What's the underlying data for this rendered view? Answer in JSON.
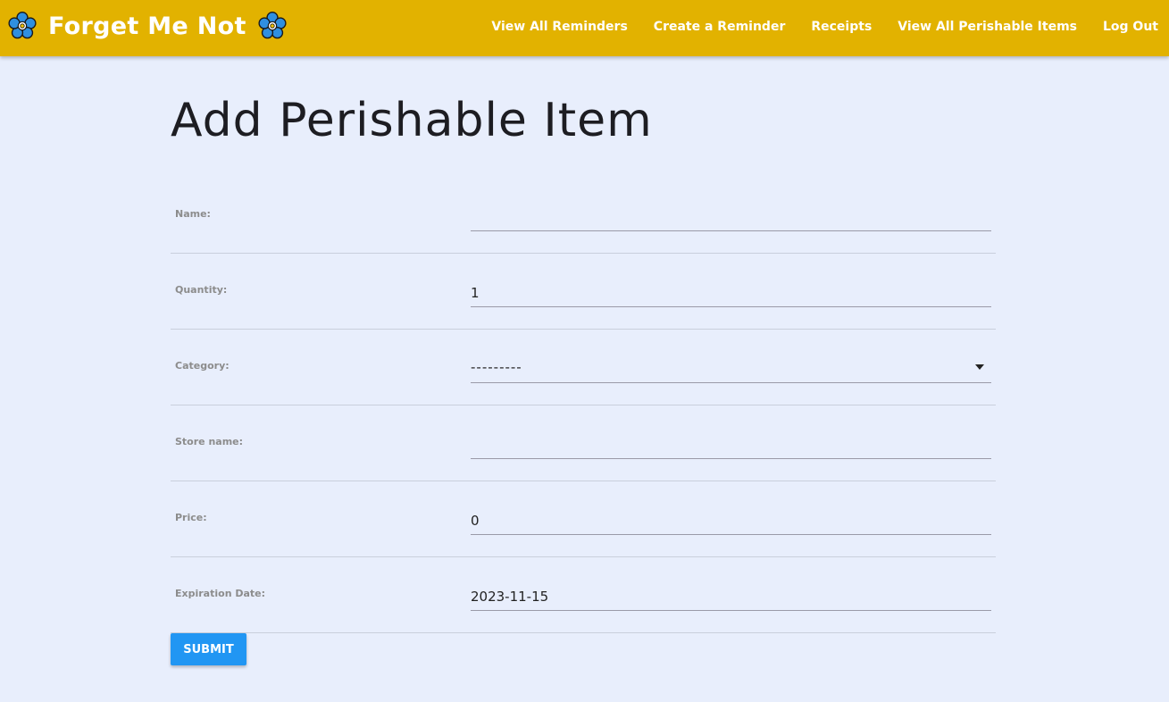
{
  "header": {
    "app_title": "Forget Me Not",
    "logo_icon": "forget-me-not-flower-icon",
    "nav": [
      {
        "label": "View All Reminders"
      },
      {
        "label": "Create a Reminder"
      },
      {
        "label": "Receipts"
      },
      {
        "label": "View All Perishable Items"
      },
      {
        "label": "Log Out"
      }
    ]
  },
  "page": {
    "title": "Add Perishable Item"
  },
  "form": {
    "name": {
      "label": "Name:",
      "value": ""
    },
    "quantity": {
      "label": "Quantity:",
      "value": "1"
    },
    "category": {
      "label": "Category:",
      "value": "---------"
    },
    "store_name": {
      "label": "Store name:",
      "value": ""
    },
    "price": {
      "label": "Price:",
      "value": "0"
    },
    "expiration_date": {
      "label": "Expiration Date:",
      "value": "2023-11-15"
    },
    "submit_label": "SUBMIT"
  },
  "colors": {
    "navbar": "#e2b200",
    "background": "#e8eefc",
    "submit": "#2196f3",
    "flower": "#2f8fe0"
  }
}
